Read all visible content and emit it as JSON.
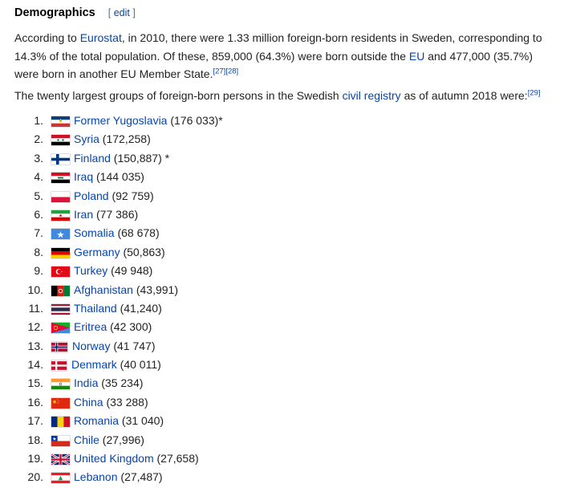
{
  "section": {
    "title": "Demographics",
    "edit_open": "[ ",
    "edit_label": "edit",
    "edit_close": " ]"
  },
  "intro": {
    "t1": "According to ",
    "link_eurostat": "Eurostat",
    "t2": ", in 2010, there were 1.33 million foreign-born residents in Sweden, corresponding to 14.3% of the total population. Of these, 859,000 (64.3%) were born outside the ",
    "link_eu": "EU",
    "t3": " and 477,000 (35.7%) were born in another EU Member State.",
    "ref1": "[27]",
    "ref2": "[28]"
  },
  "list_intro": {
    "t1": "The twenty largest groups of foreign-born persons in the Swedish ",
    "link": "civil registry",
    "t2": " as of autumn 2018 were:",
    "ref": "[29]"
  },
  "groups": [
    {
      "num": "1.",
      "country": "Former Yugoslavia",
      "count": " (176 033)*",
      "flag_icon": "yugoslavia-flag-icon"
    },
    {
      "num": "2.",
      "country": "Syria",
      "count": " (172,258)",
      "flag_icon": "syria-flag-icon"
    },
    {
      "num": "3.",
      "country": "Finland",
      "count": " (150,887) *",
      "flag_icon": "finland-flag-icon"
    },
    {
      "num": "4.",
      "country": "Iraq",
      "count": " (144 035)",
      "flag_icon": "iraq-flag-icon"
    },
    {
      "num": "5.",
      "country": "Poland",
      "count": " (92 759)",
      "flag_icon": "poland-flag-icon"
    },
    {
      "num": "6.",
      "country": "Iran",
      "count": " (77 386)",
      "flag_icon": "iran-flag-icon"
    },
    {
      "num": "7.",
      "country": "Somalia",
      "count": " (68 678)",
      "flag_icon": "somalia-flag-icon"
    },
    {
      "num": "8.",
      "country": "Germany",
      "count": " (50,863)",
      "flag_icon": "germany-flag-icon"
    },
    {
      "num": "9.",
      "country": "Turkey",
      "count": " (49 948)",
      "flag_icon": "turkey-flag-icon"
    },
    {
      "num": "10.",
      "country": "Afghanistan",
      "count": " (43,991)",
      "flag_icon": "afghanistan-flag-icon"
    },
    {
      "num": "11.",
      "country": "Thailand",
      "count": " (41,240)",
      "flag_icon": "thailand-flag-icon"
    },
    {
      "num": "12.",
      "country": "Eritrea",
      "count": " (42 300)",
      "flag_icon": "eritrea-flag-icon"
    },
    {
      "num": "13.",
      "country": "Norway",
      "count": " (41 747)",
      "flag_icon": "norway-flag-icon"
    },
    {
      "num": "14.",
      "country": "Denmark",
      "count": " (40 011)",
      "flag_icon": "denmark-flag-icon"
    },
    {
      "num": "15.",
      "country": "India",
      "count": " (35 234)",
      "flag_icon": "india-flag-icon"
    },
    {
      "num": "16.",
      "country": "China",
      "count": " (33 288)",
      "flag_icon": "china-flag-icon"
    },
    {
      "num": "17.",
      "country": "Romania",
      "count": " (31 040)",
      "flag_icon": "romania-flag-icon"
    },
    {
      "num": "18.",
      "country": "Chile",
      "count": " (27,996)",
      "flag_icon": "chile-flag-icon"
    },
    {
      "num": "19.",
      "country": "United Kingdom",
      "count": " (27,658)",
      "flag_icon": "united-kingdom-flag-icon"
    },
    {
      "num": "20.",
      "country": "Lebanon",
      "count": " (27,487)",
      "flag_icon": "lebanon-flag-icon"
    }
  ],
  "colors": {
    "link": "#0645ad",
    "text": "#222222",
    "heading": "#000000"
  }
}
